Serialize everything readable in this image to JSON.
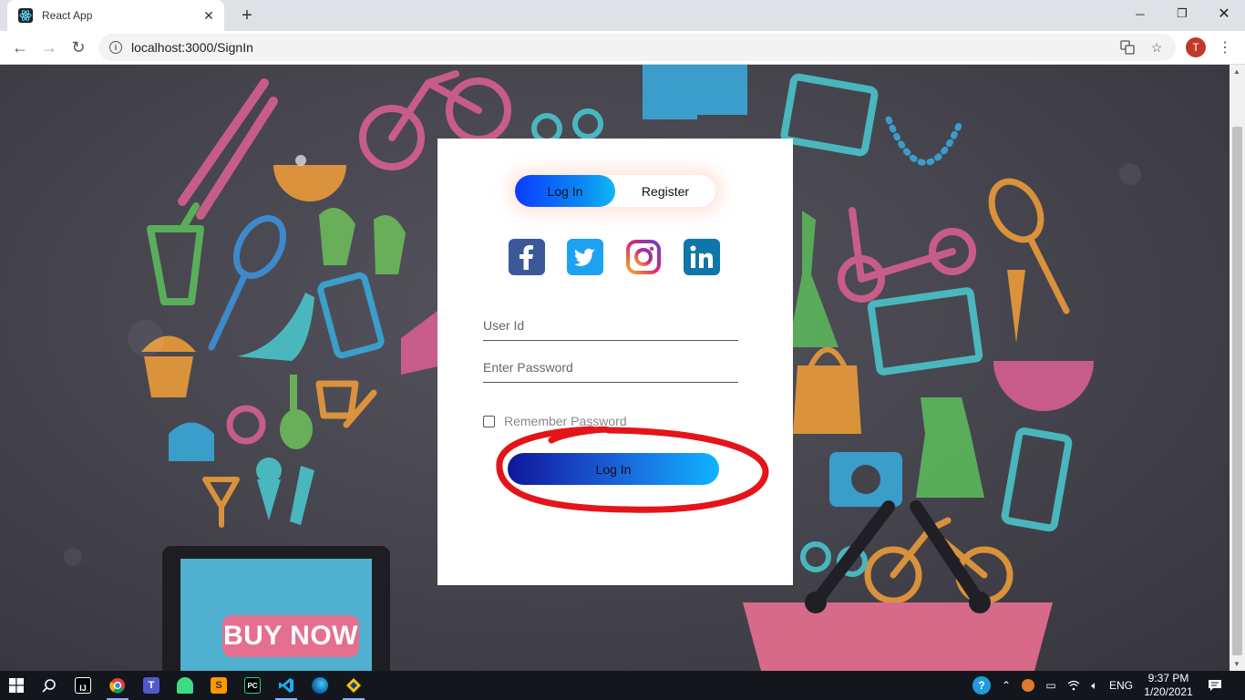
{
  "browser": {
    "tab_title": "React App",
    "url": "localhost:3000/SignIn",
    "profile_initial": "T"
  },
  "page": {
    "background_sign": "BUY NOW",
    "toggle": {
      "login_label": "Log In",
      "register_label": "Register",
      "active": "Log In"
    },
    "socials": [
      "facebook-icon",
      "twitter-icon",
      "instagram-icon",
      "linkedin-icon"
    ],
    "form": {
      "user_id_placeholder": "User Id",
      "password_placeholder": "Enter Password",
      "remember_label": "Remember Password",
      "remember_checked": false,
      "submit_label": "Log In"
    },
    "annotation_color": "#e3151a"
  },
  "taskbar": {
    "apps": [
      "start-icon",
      "search-icon",
      "intellij-icon",
      "chrome-icon",
      "teams-icon",
      "android-studio-icon",
      "sublime-icon",
      "pycharm-icon",
      "vscode-icon",
      "edge-icon",
      "sourcetree-icon"
    ],
    "language": "ENG",
    "time": "9:37 PM",
    "date": "1/20/2021"
  },
  "colors": {
    "toggle_active_start": "#0a3cff",
    "toggle_active_end": "#13b6f5",
    "login_start": "#10169a",
    "login_end": "#0fb4ff"
  }
}
